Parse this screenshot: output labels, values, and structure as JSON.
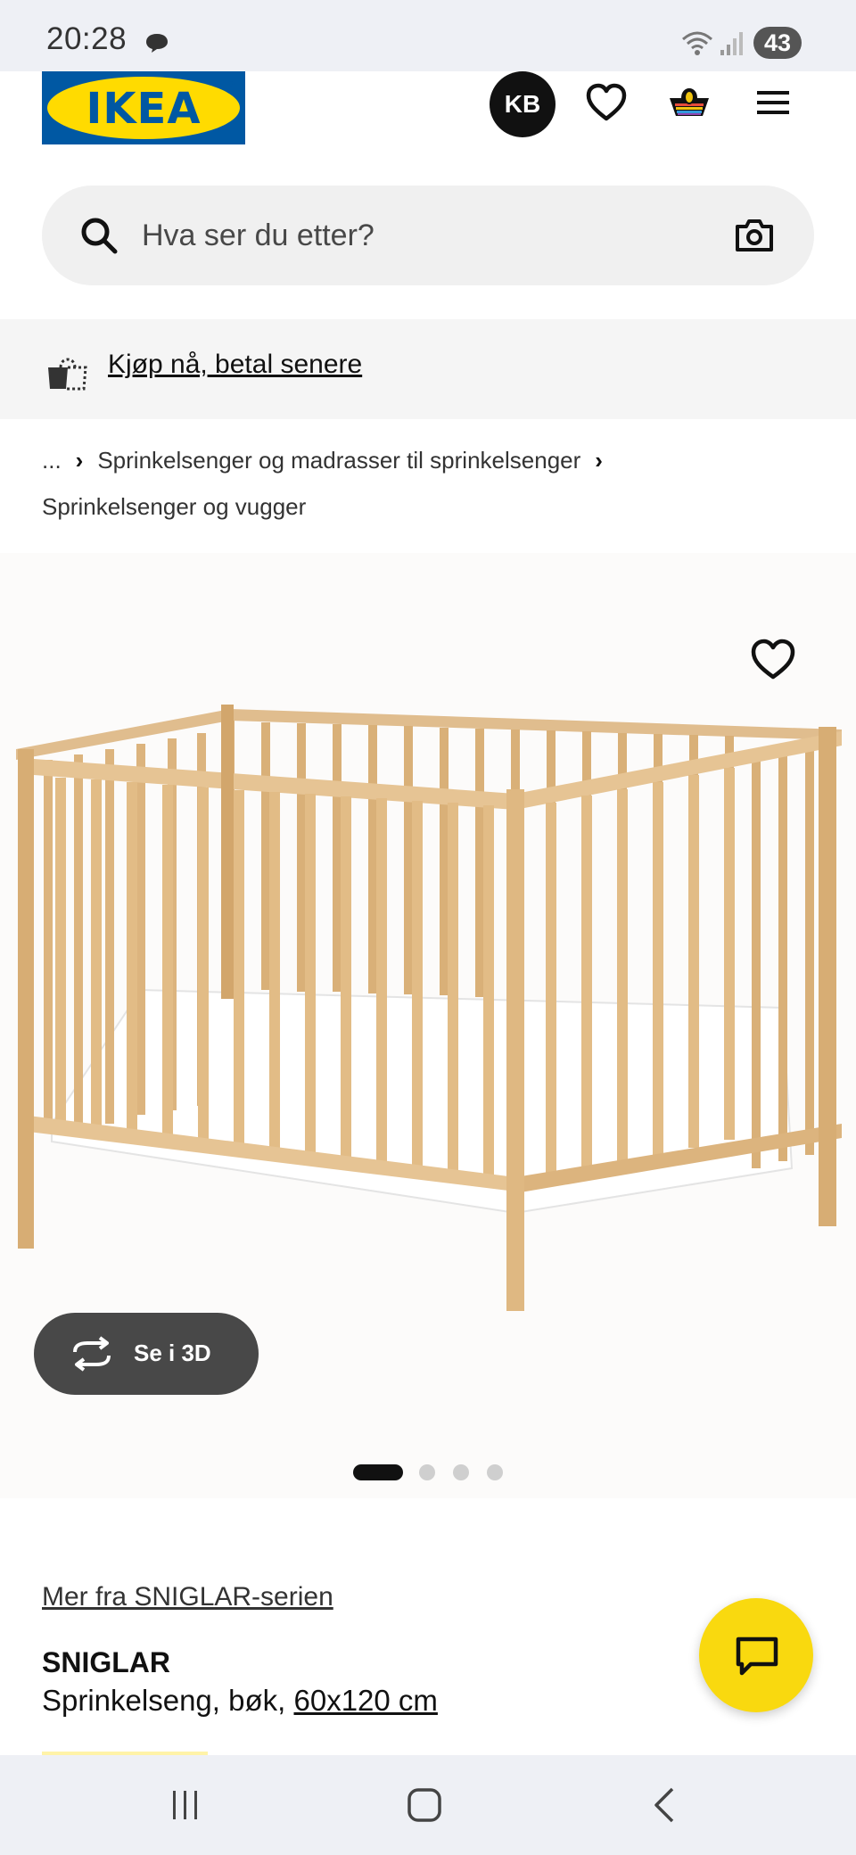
{
  "status_bar": {
    "time": "20:28",
    "battery": "43"
  },
  "header": {
    "logo_text": "IKEA",
    "logo_reg": "®",
    "avatar_initials": "KB",
    "colors": {
      "logo_blue": "#0058a3",
      "logo_yellow": "#ffdb00"
    },
    "icons": [
      "heart-icon",
      "basket-icon",
      "menu-icon"
    ]
  },
  "search": {
    "placeholder": "Hva ser du etter?",
    "value": ""
  },
  "pay_later": {
    "label": "Kjøp nå, betal senere"
  },
  "breadcrumb": {
    "ellipsis": "...",
    "items": [
      "Sprinkelsenger og madrasser til sprinkelsenger",
      "Sprinkelsenger og vugger"
    ],
    "separator": "›"
  },
  "gallery": {
    "view_3d_label": "Se i 3D",
    "total_images": 4,
    "active_index": 0
  },
  "product": {
    "series_link": "Mer fra SNIGLAR-serien",
    "name": "SNIGLAR",
    "description": "Sprinkelseng, bøk,",
    "size": "60x120 cm"
  },
  "chat": {
    "accent_color": "#f9d90f"
  }
}
